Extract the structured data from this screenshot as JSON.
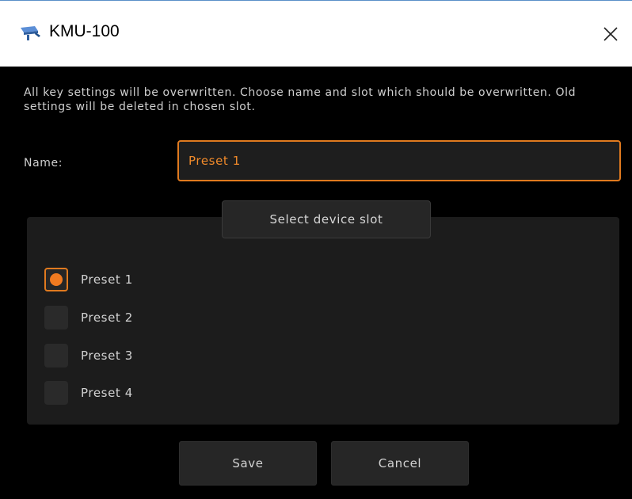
{
  "window": {
    "title": "KMU-100",
    "app_icon": "kmu-device-icon",
    "close_icon": "close-icon"
  },
  "dialog": {
    "description": "All key settings will be overwritten. Choose name and slot which should be overwritten. Old settings will be deleted in chosen slot.",
    "name_label": "Name:",
    "name_value": "Preset 1",
    "slot_button_label": "Select device slot",
    "presets": [
      {
        "label": "Preset 1",
        "selected": true
      },
      {
        "label": "Preset 2",
        "selected": false
      },
      {
        "label": "Preset 3",
        "selected": false
      },
      {
        "label": "Preset 4",
        "selected": false
      }
    ],
    "save_label": "Save",
    "cancel_label": "Cancel"
  },
  "colors": {
    "accent": "#e07a1f",
    "background": "#000000",
    "panel": "#1c1c1c",
    "text": "#cfcfcf"
  }
}
